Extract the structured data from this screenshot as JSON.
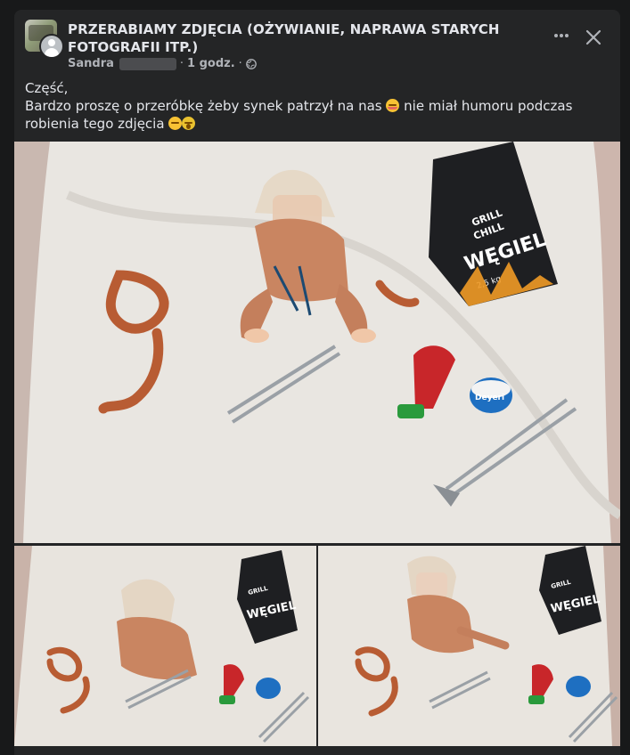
{
  "post": {
    "group_name": "PRZERABIAMY ZDJĘCIA (OŻYWIANIE, NAPRAWA STARYCH FOTOGRAFII ITP.)",
    "author": "Sandra",
    "separator_1": "·",
    "time": "1 godz.",
    "separator_2": "·",
    "privacy_icon": "globe-icon",
    "more_icon": "ellipsis-icon",
    "close_icon": "close-icon",
    "text_line_1": "Część,",
    "text_line_2": "Bardzo proszę o przeróbkę żeby synek patrzył na nas",
    "text_line_2b": "nie miał humoru podczas",
    "text_line_3": "robienia tego zdjęcia",
    "emojis": [
      "smiling-blush-emoji",
      "relieved-emoji",
      "screaming-emoji"
    ],
    "photos": [
      {
        "name": "photo-main",
        "description_icon": "baby-on-blanket-photo"
      },
      {
        "name": "photo-bottom-left",
        "description_icon": "baby-on-blanket-photo"
      },
      {
        "name": "photo-bottom-right",
        "description_icon": "baby-on-blanket-photo"
      }
    ],
    "photo_text": {
      "brand_line_1": "GRILL",
      "brand_line_2": "CHILL",
      "product": "WĘGIEL",
      "weight": "2,5 kg",
      "snack": "Deyeri"
    }
  },
  "colors": {
    "background": "#18191a",
    "card": "#242526",
    "primary_text": "#e4e6eb",
    "secondary_text": "#b0b3b8"
  }
}
